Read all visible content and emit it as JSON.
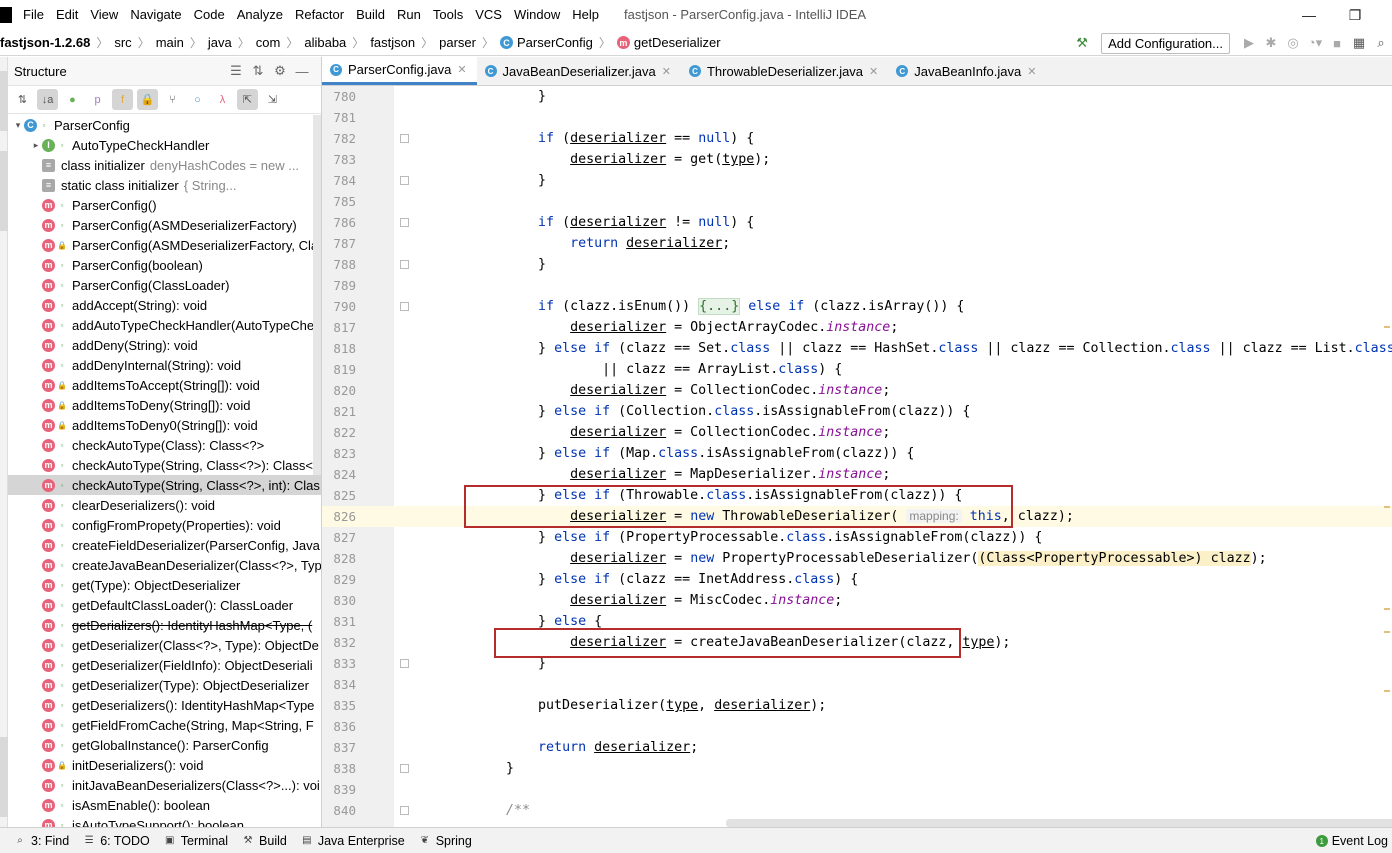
{
  "window": {
    "title": "fastjson - ParserConfig.java - IntelliJ IDEA",
    "minimize_glyph": "—",
    "maximize_glyph": "❐"
  },
  "menu": [
    "File",
    "Edit",
    "View",
    "Navigate",
    "Code",
    "Analyze",
    "Refactor",
    "Build",
    "Run",
    "Tools",
    "VCS",
    "Window",
    "Help"
  ],
  "breadcrumbs": {
    "project": "fastjson-1.2.68",
    "path": [
      "src",
      "main",
      "java",
      "com",
      "alibaba",
      "fastjson",
      "parser"
    ],
    "class": "ParserConfig",
    "method": "getDeserializer"
  },
  "toolbar": {
    "add_configuration": "Add Configuration..."
  },
  "structure": {
    "title": "Structure",
    "items": [
      {
        "label": "ParserConfig",
        "kind": "c",
        "level": 0,
        "arrow": "▾"
      },
      {
        "label": "AutoTypeCheckHandler",
        "kind": "i",
        "level": 1,
        "arrow": "▸"
      },
      {
        "label": "class initializer",
        "extra": "denyHashCodes = new ...",
        "kind": "init",
        "level": 1
      },
      {
        "label": "static class initializer",
        "extra": "{            String...",
        "kind": "init",
        "level": 1
      },
      {
        "label": "ParserConfig()",
        "kind": "m",
        "level": 1,
        "vis": "pub"
      },
      {
        "label": "ParserConfig(ASMDeserializerFactory)",
        "kind": "m",
        "level": 1,
        "vis": "pub"
      },
      {
        "label": "ParserConfig(ASMDeserializerFactory, Cla",
        "kind": "m",
        "level": 1,
        "vis": "lock"
      },
      {
        "label": "ParserConfig(boolean)",
        "kind": "m",
        "level": 1,
        "vis": "pub"
      },
      {
        "label": "ParserConfig(ClassLoader)",
        "kind": "m",
        "level": 1,
        "vis": "pub"
      },
      {
        "label": "addAccept(String): void",
        "kind": "m",
        "level": 1,
        "vis": "pub"
      },
      {
        "label": "addAutoTypeCheckHandler(AutoTypeChe",
        "kind": "m",
        "level": 1,
        "vis": "pub"
      },
      {
        "label": "addDeny(String): void",
        "kind": "m",
        "level": 1,
        "vis": "pub"
      },
      {
        "label": "addDenyInternal(String): void",
        "kind": "m",
        "level": 1,
        "vis": "pub"
      },
      {
        "label": "addItemsToAccept(String[]): void",
        "kind": "m",
        "level": 1,
        "vis": "lock"
      },
      {
        "label": "addItemsToDeny(String[]): void",
        "kind": "m",
        "level": 1,
        "vis": "lock"
      },
      {
        "label": "addItemsToDeny0(String[]): void",
        "kind": "m",
        "level": 1,
        "vis": "lock"
      },
      {
        "label": "checkAutoType(Class): Class<?>",
        "kind": "m",
        "level": 1,
        "vis": "pub"
      },
      {
        "label": "checkAutoType(String, Class<?>): Class<?",
        "kind": "m",
        "level": 1,
        "vis": "pub"
      },
      {
        "label": "checkAutoType(String, Class<?>, int): Clas",
        "kind": "m",
        "level": 1,
        "vis": "pub",
        "selected": true
      },
      {
        "label": "clearDeserializers(): void",
        "kind": "m",
        "level": 1,
        "vis": "pub"
      },
      {
        "label": "configFromPropety(Properties): void",
        "kind": "m",
        "level": 1,
        "vis": "pub"
      },
      {
        "label": "createFieldDeserializer(ParserConfig, Java",
        "kind": "m",
        "level": 1,
        "vis": "pub"
      },
      {
        "label": "createJavaBeanDeserializer(Class<?>, Typ",
        "kind": "m",
        "level": 1,
        "vis": "pub"
      },
      {
        "label": "get(Type): ObjectDeserializer",
        "kind": "m",
        "level": 1,
        "vis": "pub"
      },
      {
        "label": "getDefaultClassLoader(): ClassLoader",
        "kind": "m",
        "level": 1,
        "vis": "pub"
      },
      {
        "label": "getDerializers(): IdentityHashMap<Type, (",
        "kind": "m",
        "level": 1,
        "vis": "pub",
        "strike": true
      },
      {
        "label": "getDeserializer(Class<?>, Type): ObjectDe",
        "kind": "m",
        "level": 1,
        "vis": "pub"
      },
      {
        "label": "getDeserializer(FieldInfo): ObjectDeseriali",
        "kind": "m",
        "level": 1,
        "vis": "pub"
      },
      {
        "label": "getDeserializer(Type): ObjectDeserializer",
        "kind": "m",
        "level": 1,
        "vis": "pub"
      },
      {
        "label": "getDeserializers(): IdentityHashMap<Type",
        "kind": "m",
        "level": 1,
        "vis": "pub"
      },
      {
        "label": "getFieldFromCache(String, Map<String, F",
        "kind": "m",
        "level": 1,
        "vis": "pub"
      },
      {
        "label": "getGlobalInstance(): ParserConfig",
        "kind": "m",
        "level": 1,
        "vis": "pub"
      },
      {
        "label": "initDeserializers(): void",
        "kind": "m",
        "level": 1,
        "vis": "lock"
      },
      {
        "label": "initJavaBeanDeserializers(Class<?>...): voi",
        "kind": "m",
        "level": 1,
        "vis": "pub"
      },
      {
        "label": "isAsmEnable(): boolean",
        "kind": "m",
        "level": 1,
        "vis": "pub"
      },
      {
        "label": "isAutoTypeSupport(): boolean",
        "kind": "m",
        "level": 1,
        "vis": "pub"
      }
    ]
  },
  "tabs": [
    {
      "label": "ParserConfig.java",
      "active": true
    },
    {
      "label": "JavaBeanDeserializer.java"
    },
    {
      "label": "ThrowableDeserializer.java"
    },
    {
      "label": "JavaBeanInfo.java"
    }
  ],
  "editor": {
    "lines": [
      {
        "n": "780",
        "html": "        }"
      },
      {
        "n": "781",
        "html": ""
      },
      {
        "n": "782",
        "html": "        <span class='kw'>if</span> (<span class='local'>deserializer</span> == <span class='kw'>null</span>) {"
      },
      {
        "n": "783",
        "html": "            <span class='local'>deserializer</span> = get(<span class='local'>type</span>);"
      },
      {
        "n": "784",
        "html": "        }"
      },
      {
        "n": "785",
        "html": ""
      },
      {
        "n": "786",
        "html": "        <span class='kw'>if</span> (<span class='local'>deserializer</span> != <span class='kw'>null</span>) {"
      },
      {
        "n": "787",
        "html": "            <span class='kw'>return</span> <span class='local'>deserializer</span>;"
      },
      {
        "n": "788",
        "html": "        }"
      },
      {
        "n": "789",
        "html": ""
      },
      {
        "n": "790",
        "html": "        <span class='kw'>if</span> (clazz.isEnum()) <span class='foldtxt'>{...}</span> <span class='kw'>else if</span> (clazz.isArray()) {"
      },
      {
        "n": "817",
        "html": "            <span class='local'>deserializer</span> = ObjectArrayCodec.<span class='fld'>instance</span>;"
      },
      {
        "n": "818",
        "html": "        } <span class='kw'>else if</span> (clazz == Set.<span class='kw'>class</span> || clazz == HashSet.<span class='kw'>class</span> || clazz == Collection.<span class='kw'>class</span> || clazz == List.<span class='kw'>class</span>"
      },
      {
        "n": "819",
        "html": "                || clazz == ArrayList.<span class='kw'>class</span>) {"
      },
      {
        "n": "820",
        "html": "            <span class='local'>deserializer</span> = CollectionCodec.<span class='fld'>instance</span>;"
      },
      {
        "n": "821",
        "html": "        } <span class='kw'>else if</span> (Collection.<span class='kw'>class</span>.isAssignableFrom(clazz)) {"
      },
      {
        "n": "822",
        "html": "            <span class='local'>deserializer</span> = CollectionCodec.<span class='fld'>instance</span>;"
      },
      {
        "n": "823",
        "html": "        } <span class='kw'>else if</span> (Map.<span class='kw'>class</span>.isAssignableFrom(clazz)) {"
      },
      {
        "n": "824",
        "html": "            <span class='local'>deserializer</span> = MapDeserializer.<span class='fld'>instance</span>;"
      },
      {
        "n": "825",
        "html": "        } <span class='kw'>else if</span> (Throwable.<span class='kw'>class</span>.isAssignableFrom(clazz)) {"
      },
      {
        "n": "826",
        "html": "            <span class='local'>deserializer</span> = <span class='kw'>new</span> ThrowableDeserializer( <span class='hint'>mapping:</span> <span class='kw'>this</span>, clazz);",
        "current": true
      },
      {
        "n": "827",
        "html": "        } <span class='kw'>else if</span> (PropertyProcessable.<span class='kw'>class</span>.isAssignableFrom(clazz)) {"
      },
      {
        "n": "828",
        "html": "            <span class='local'>deserializer</span> = <span class='kw'>new</span> PropertyProcessableDeserializer(<span class='cast'>(Class&lt;PropertyProcessable&gt;) clazz</span>);"
      },
      {
        "n": "829",
        "html": "        } <span class='kw'>else if</span> (clazz == InetAddress.<span class='kw'>class</span>) {"
      },
      {
        "n": "830",
        "html": "            <span class='local'>deserializer</span> = MiscCodec.<span class='fld'>instance</span>;"
      },
      {
        "n": "831",
        "html": "        } <span class='kw'>else</span> {"
      },
      {
        "n": "832",
        "html": "            <span class='local'>deserializer</span> = createJavaBeanDeserializer(clazz, <span class='local'>type</span>);"
      },
      {
        "n": "833",
        "html": "        }"
      },
      {
        "n": "834",
        "html": ""
      },
      {
        "n": "835",
        "html": "        putDeserializer(<span class='local'>type</span>, <span class='local'>deserializer</span>);"
      },
      {
        "n": "836",
        "html": ""
      },
      {
        "n": "837",
        "html": "        <span class='kw'>return</span> <span class='local'>deserializer</span>;"
      },
      {
        "n": "838",
        "html": "    }"
      },
      {
        "n": "839",
        "html": ""
      },
      {
        "n": "840",
        "html": "    <span style='color:#8c8c8c;font-style:italic'>/**</span>"
      }
    ]
  },
  "bottombar": {
    "items": [
      {
        "label": "3: Find",
        "icon": "search-icon"
      },
      {
        "label": "6: TODO",
        "icon": "todo-icon"
      },
      {
        "label": "Terminal",
        "icon": "terminal-icon"
      },
      {
        "label": "Build",
        "icon": "hammer-icon"
      },
      {
        "label": "Java Enterprise",
        "icon": "enterprise-icon"
      },
      {
        "label": "Spring",
        "icon": "spring-icon"
      }
    ],
    "event_log": "Event Log"
  }
}
